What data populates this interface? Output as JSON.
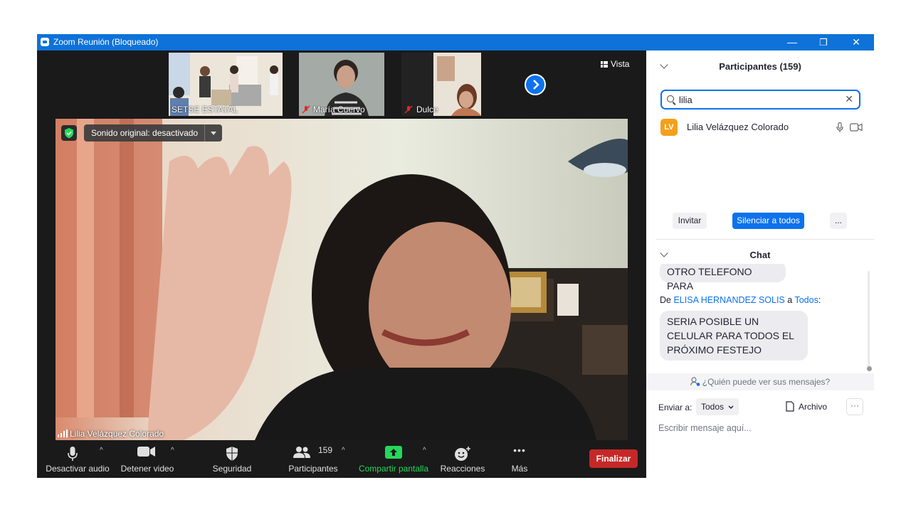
{
  "window": {
    "title": "Zoom Reunión (Bloqueado)",
    "minimize_glyph": "—",
    "restore_glyph": "❐",
    "close_glyph": "✕"
  },
  "gallery": {
    "thumbnails": [
      {
        "name": "SETSE ESTATAL",
        "muted": false
      },
      {
        "name": "María Cuervo",
        "muted": true
      },
      {
        "name": "Dulce",
        "muted": true
      }
    ],
    "next_icon": "chevron-right-icon",
    "view_label": "Vista"
  },
  "main_video": {
    "participant_name": "Lilia Velázquez Colorado",
    "original_sound_label": "Sonido original: desactivado",
    "security_color": "#23d959"
  },
  "toolbar": {
    "mute_label": "Desactivar audio",
    "video_label": "Detener video",
    "security_label": "Seguridad",
    "participants_label": "Participantes",
    "participants_count": "159",
    "share_label": "Compartir pantalla",
    "reactions_label": "Reacciones",
    "more_label": "Más",
    "end_label": "Finalizar",
    "up_glyph": "^",
    "more_glyph": "•••",
    "share_color": "#23d959",
    "end_color": "#c62828"
  },
  "participants_panel": {
    "title": "Participantes (159)",
    "search_value": "lilia",
    "clear_glyph": "✕",
    "results": [
      {
        "initials": "LV",
        "name": "Lilia Velázquez Colorado",
        "avatar_color": "#f4a01a"
      }
    ],
    "invite_label": "Invitar",
    "mute_all_label": "Silenciar a todos",
    "more_label": "..."
  },
  "chat": {
    "title": "Chat",
    "prev_message_fragment": "OTRO TELEFONO PARA",
    "messages": [
      {
        "prefix": "De",
        "sender": "ELISA HERNANDEZ SOLIS",
        "to_word": "a",
        "recipient": "Todos",
        "text": "SERIA POSIBLE UN CELULAR PARA TODOS EL PRÓXIMO FESTEJO"
      }
    ],
    "privacy_note": "¿Quién puede ver sus mensajes?",
    "send_to_label": "Enviar a:",
    "send_to_value": "Todos",
    "file_label": "Archivo",
    "more_glyph": "···",
    "input_placeholder": "Escribir mensaje aquí..."
  }
}
